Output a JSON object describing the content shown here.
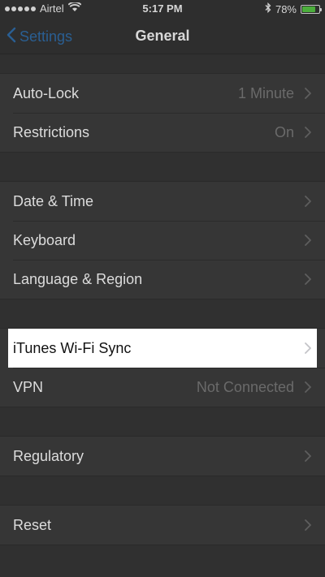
{
  "status_bar": {
    "carrier": "Airtel",
    "time": "5:17 PM",
    "battery_percent_text": "78%",
    "battery_level": 0.78
  },
  "nav": {
    "back_label": "Settings",
    "title": "General"
  },
  "groups": [
    {
      "rows": [
        {
          "label": "Auto-Lock",
          "value": "1 Minute"
        },
        {
          "label": "Restrictions",
          "value": "On"
        }
      ]
    },
    {
      "rows": [
        {
          "label": "Date & Time",
          "value": ""
        },
        {
          "label": "Keyboard",
          "value": ""
        },
        {
          "label": "Language & Region",
          "value": ""
        }
      ]
    },
    {
      "rows": [
        {
          "label": "iTunes Wi-Fi Sync",
          "value": "",
          "highlighted": true
        },
        {
          "label": "VPN",
          "value": "Not Connected"
        }
      ]
    },
    {
      "rows": [
        {
          "label": "Regulatory",
          "value": ""
        }
      ]
    },
    {
      "rows": [
        {
          "label": "Reset",
          "value": ""
        }
      ]
    }
  ],
  "colors": {
    "accent": "#2a5f93",
    "highlight_bg": "#ffffff",
    "battery_fill": "#4cae3c"
  }
}
